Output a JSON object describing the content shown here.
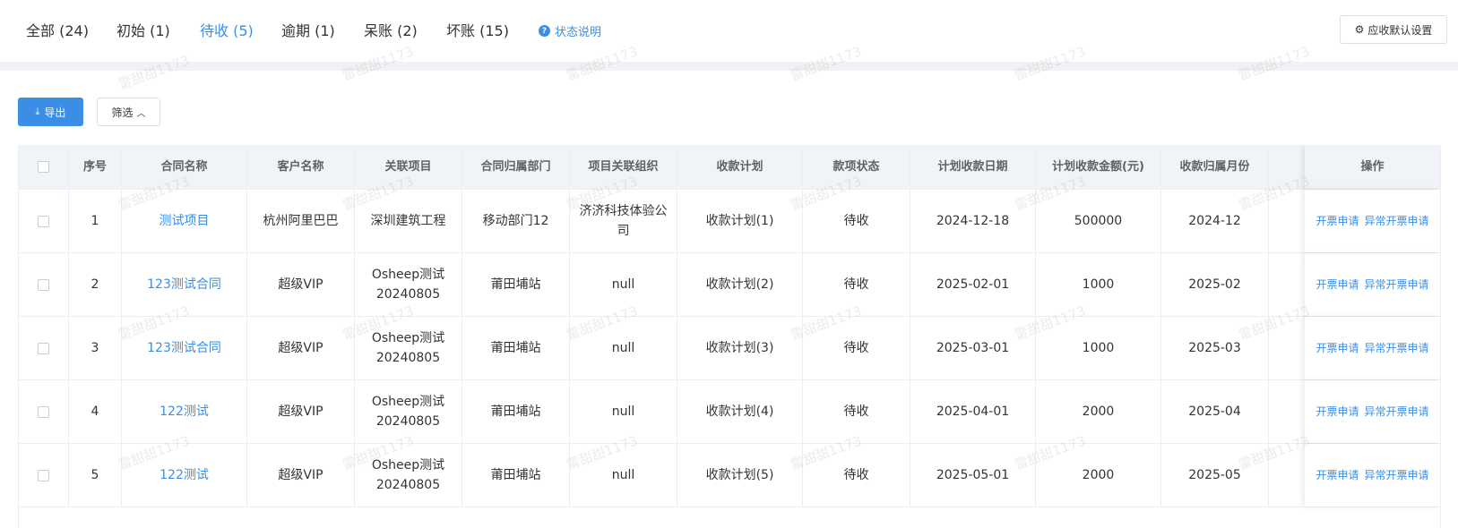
{
  "tabs": [
    {
      "label": "全部 (24)",
      "active": false
    },
    {
      "label": "初始 (1)",
      "active": false
    },
    {
      "label": "待收 (5)",
      "active": true
    },
    {
      "label": "逾期 (1)",
      "active": false
    },
    {
      "label": "呆账 (2)",
      "active": false
    },
    {
      "label": "坏账 (15)",
      "active": false
    }
  ],
  "help_label": "状态说明",
  "settings_label": "应收默认设置",
  "toolbar": {
    "export_label": "导出",
    "filter_label": "筛选"
  },
  "columns": [
    "序号",
    "合同名称",
    "客户名称",
    "关联项目",
    "合同归属部门",
    "项目关联组织",
    "收款计划",
    "款项状态",
    "计划收款日期",
    "计划收款金额(元)",
    "收款归属月份",
    "操作"
  ],
  "rows": [
    {
      "index": "1",
      "contract": "测试项目",
      "customer": "杭州阿里巴巴",
      "project": "深圳建筑工程",
      "department": "移动部门12",
      "organization": "济济科技体验公司",
      "plan": "收款计划(1)",
      "status": "待收",
      "date": "2024-12-18",
      "amount": "500000",
      "month": "2024-12"
    },
    {
      "index": "2",
      "contract": "123测试合同",
      "customer": "超级VIP",
      "project": "Osheep测试20240805",
      "department": "莆田埔站",
      "organization": "null",
      "plan": "收款计划(2)",
      "status": "待收",
      "date": "2025-02-01",
      "amount": "1000",
      "month": "2025-02"
    },
    {
      "index": "3",
      "contract": "123测试合同",
      "customer": "超级VIP",
      "project": "Osheep测试20240805",
      "department": "莆田埔站",
      "organization": "null",
      "plan": "收款计划(3)",
      "status": "待收",
      "date": "2025-03-01",
      "amount": "1000",
      "month": "2025-03"
    },
    {
      "index": "4",
      "contract": "122测试",
      "customer": "超级VIP",
      "project": "Osheep测试20240805",
      "department": "莆田埔站",
      "organization": "null",
      "plan": "收款计划(4)",
      "status": "待收",
      "date": "2025-04-01",
      "amount": "2000",
      "month": "2025-04"
    },
    {
      "index": "5",
      "contract": "122测试",
      "customer": "超级VIP",
      "project": "Osheep测试20240805",
      "department": "莆田埔站",
      "organization": "null",
      "plan": "收款计划(5)",
      "status": "待收",
      "date": "2025-05-01",
      "amount": "2000",
      "month": "2025-05"
    }
  ],
  "actions": {
    "invoice": "开票申请",
    "abnormal_invoice": "异常开票申请"
  },
  "watermark": "雷甜甜1173",
  "colors": {
    "primary": "#3a8ee6",
    "header_bg": "#f0f3f7",
    "border": "#ebeef5"
  },
  "icons": {
    "help": "question-circle-icon",
    "settings": "gear-icon",
    "export": "download-icon",
    "filter": "chevron-up-icon"
  }
}
